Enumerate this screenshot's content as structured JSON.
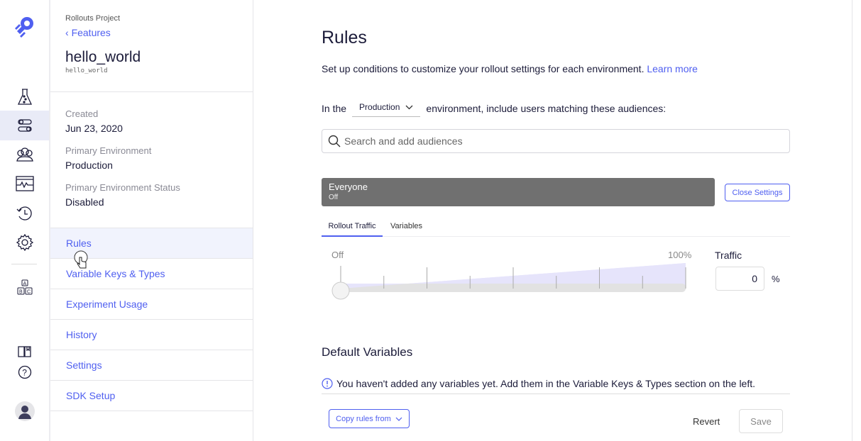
{
  "colors": {
    "accent": "#4f5ff0",
    "rule_bar": "#707070",
    "slider_fill": "#e6e4fb"
  },
  "rail": {
    "icons": [
      "rocket-logo",
      "experiments-flask-icon",
      "features-toggle-icon",
      "audiences-icon",
      "monitoring-icon",
      "history-icon",
      "settings-gear-icon",
      "abc-variables-icon",
      "docs-book-icon",
      "help-icon",
      "user-avatar"
    ]
  },
  "panel": {
    "project": "Rollouts Project",
    "back_link": "Features",
    "feature_name": "hello_world",
    "feature_key": "hello_world",
    "meta": [
      {
        "label": "Created",
        "value": "Jun 23, 2020"
      },
      {
        "label": "Primary Environment",
        "value": "Production"
      },
      {
        "label": "Primary Environment Status",
        "value": "Disabled"
      }
    ],
    "nav": [
      "Rules",
      "Variable Keys & Types",
      "Experiment Usage",
      "History",
      "Settings",
      "SDK Setup"
    ]
  },
  "main": {
    "title": "Rules",
    "description": "Set up conditions to customize your rollout settings for each environment.",
    "learn_more": "Learn more",
    "env_prefix": "In the",
    "environment": "Production",
    "env_suffix": "environment, include users matching these audiences:",
    "search_placeholder": "Search and add audiences",
    "rule": {
      "name": "Everyone",
      "status": "Off"
    },
    "close_settings": "Close Settings",
    "tabs": [
      "Rollout Traffic",
      "Variables"
    ],
    "active_tab": 0,
    "slider": {
      "min_label": "Off",
      "max_label": "100%",
      "value_percent": 0
    },
    "traffic_label": "Traffic",
    "traffic_value": "0",
    "traffic_unit": "%",
    "default_vars_title": "Default Variables",
    "default_vars_notice": "You haven't added any variables yet. Add them in the Variable Keys & Types section on the left.",
    "copy_rules": "Copy rules from",
    "revert": "Revert",
    "save": "Save"
  }
}
